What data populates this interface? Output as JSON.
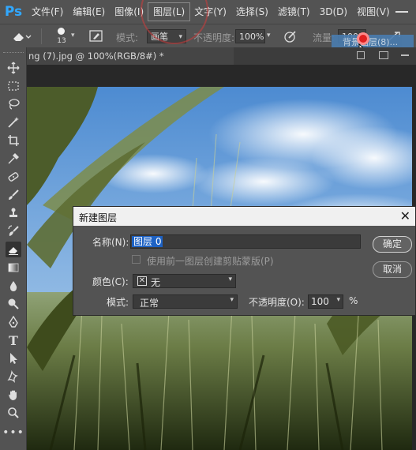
{
  "app": {
    "logo": "Ps",
    "menus": [
      "文件(F)",
      "编辑(E)",
      "图像(I)",
      "图层(L)",
      "文字(Y)",
      "选择(S)",
      "滤镜(T)",
      "3D(D)",
      "视图(V)"
    ],
    "active_menu_index": 3
  },
  "options_bar": {
    "brush_size": "13",
    "mode_label": "模式:",
    "mode_value": "画笔",
    "opacity_label": "不透明度:",
    "opacity_value": "100%",
    "flow_label": "流量:",
    "flow_value": "100%",
    "hint_text": "背景图层(8)..."
  },
  "document": {
    "tab_title": "ng (7).jpg @ 100%(RGB/8#) *"
  },
  "tools": [
    "move-icon",
    "marquee-icon",
    "lasso-icon",
    "magic-wand-icon",
    "crop-icon",
    "eyedropper-icon",
    "healing-icon",
    "brush-icon",
    "stamp-icon",
    "history-brush-icon",
    "eraser-icon",
    "gradient-icon",
    "blur-icon",
    "dodge-icon",
    "pen-icon",
    "type-icon",
    "path-select-icon",
    "shape-icon",
    "hand-icon",
    "zoom-icon",
    "more-icon"
  ],
  "dialog": {
    "title": "新建图层",
    "close": "✕",
    "name_label": "名称(N):",
    "name_value": "图层 0",
    "clip_checkbox_label": "使用前一图层创建剪贴蒙版(P)",
    "color_label": "颜色(C):",
    "color_value": "无",
    "mode_label": "模式:",
    "mode_value": "正常",
    "opacity_label": "不透明度(O):",
    "opacity_value": "100",
    "opacity_unit": "%",
    "ok_label": "确定",
    "cancel_label": "取消"
  },
  "colors": {
    "chrome": "#535353",
    "selection": "#1d62c4",
    "accent_logo": "#31a8ff"
  }
}
